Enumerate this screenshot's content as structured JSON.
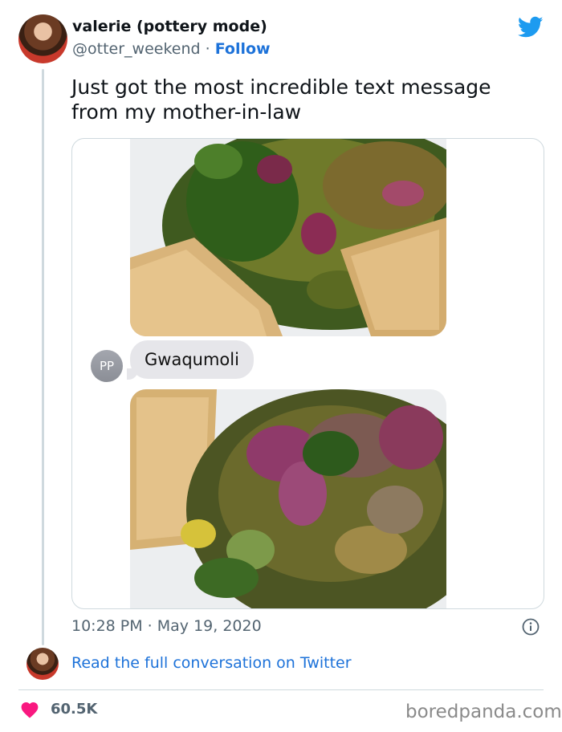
{
  "header": {
    "display_name": "valerie (pottery mode)",
    "handle": "@otter_weekend",
    "separator": "·",
    "follow_label": "Follow",
    "platform_icon": "twitter-bird-icon"
  },
  "tweet": {
    "text": "Just got the most incredible text message from my mother-in-law"
  },
  "media": {
    "contact_initials": "PP",
    "message_text": "Gwaqumoli"
  },
  "footer": {
    "timestamp": "10:28 PM · May 19, 2020",
    "info_icon": "info-icon",
    "read_more": "Read the full conversation on Twitter",
    "like_icon": "heart-icon",
    "like_count": "60.5K",
    "watermark": "boredpanda.com"
  },
  "colors": {
    "link": "#1d72d9",
    "twitter_blue": "#1d9bf0",
    "heart": "#f91880",
    "muted_text": "#536471",
    "bubble": "#e6e6ea"
  }
}
